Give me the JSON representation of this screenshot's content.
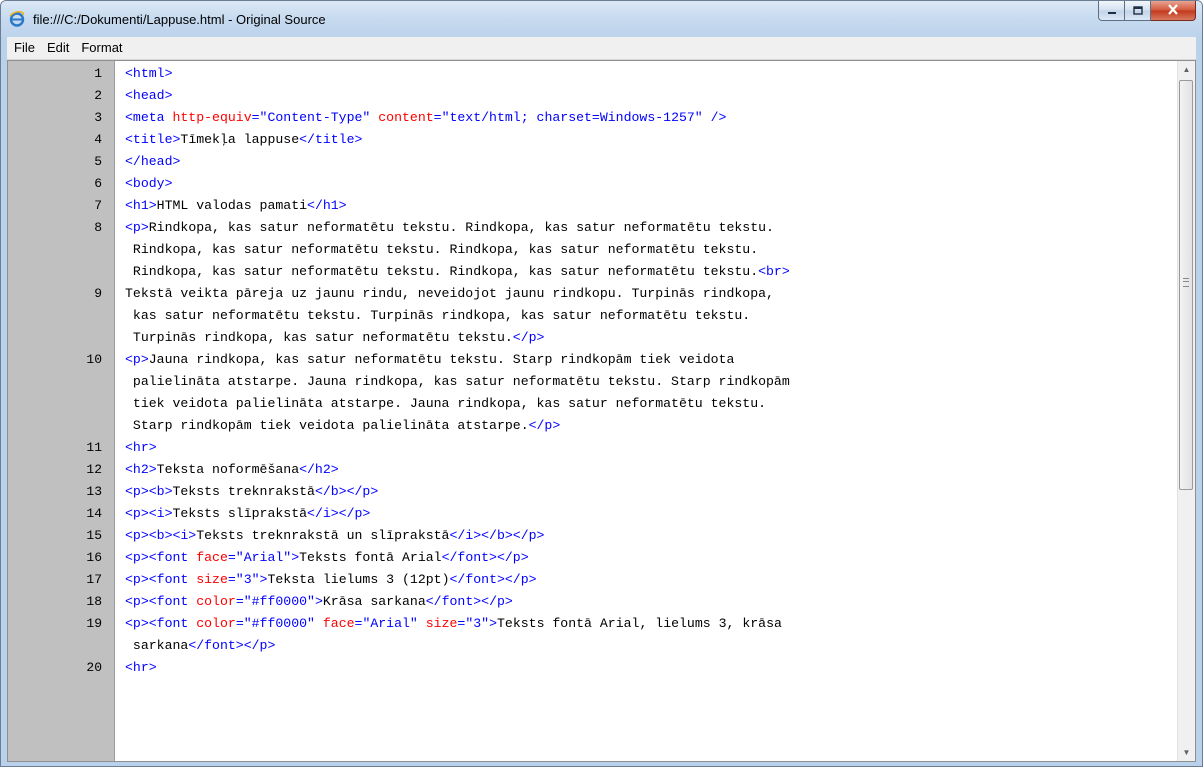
{
  "window": {
    "title": "file:///C:/Dokumenti/Lappuse.html - Original Source",
    "app_icon": "internet-explorer-icon",
    "buttons": {
      "minimize": "minimize-icon",
      "maximize": "maximize-icon",
      "close": "close-icon"
    }
  },
  "menu": {
    "items": [
      "File",
      "Edit",
      "Format"
    ]
  },
  "colors": {
    "tag": "#0000ff",
    "attribute": "#ff0000",
    "attribute_value": "#0000ff",
    "text": "#000000",
    "gutter": "#c0c0c0"
  },
  "source": {
    "lines": [
      {
        "num": "1",
        "rows": [
          [
            [
              "tag",
              "<html>"
            ]
          ]
        ]
      },
      {
        "num": "2",
        "rows": [
          [
            [
              "tag",
              "<head>"
            ]
          ]
        ]
      },
      {
        "num": "3",
        "rows": [
          [
            [
              "tag",
              "<meta "
            ],
            [
              "attr",
              "http-equiv"
            ],
            [
              "tag",
              "=\"Content-Type\" "
            ],
            [
              "attr",
              "content"
            ],
            [
              "tag",
              "=\"text/html; charset=Windows-1257\" />"
            ]
          ]
        ]
      },
      {
        "num": "4",
        "rows": [
          [
            [
              "tag",
              "<title>"
            ],
            [
              "text",
              "Tīmekļa lappuse"
            ],
            [
              "tag",
              "</title>"
            ]
          ]
        ]
      },
      {
        "num": "5",
        "rows": [
          [
            [
              "tag",
              "</head>"
            ]
          ]
        ]
      },
      {
        "num": "6",
        "rows": [
          [
            [
              "tag",
              "<body>"
            ]
          ]
        ]
      },
      {
        "num": "7",
        "rows": [
          [
            [
              "tag",
              "<h1>"
            ],
            [
              "text",
              "HTML valodas pamati"
            ],
            [
              "tag",
              "</h1>"
            ]
          ]
        ]
      },
      {
        "num": "8",
        "rows": [
          [
            [
              "tag",
              "<p>"
            ],
            [
              "text",
              "Rindkopa, kas satur neformatētu tekstu. Rindkopa, kas satur neformatētu tekstu."
            ]
          ],
          [
            [
              "text",
              " Rindkopa, kas satur neformatētu tekstu. Rindkopa, kas satur neformatētu tekstu."
            ]
          ],
          [
            [
              "text",
              " Rindkopa, kas satur neformatētu tekstu. Rindkopa, kas satur neformatētu tekstu."
            ],
            [
              "tag",
              "<br>"
            ]
          ]
        ]
      },
      {
        "num": "9",
        "rows": [
          [
            [
              "text",
              "Tekstā veikta pāreja uz jaunu rindu, neveidojot jaunu rindkopu. Turpinās rindkopa,"
            ]
          ],
          [
            [
              "text",
              " kas satur neformatētu tekstu. Turpinās rindkopa, kas satur neformatētu tekstu."
            ]
          ],
          [
            [
              "text",
              " Turpinās rindkopa, kas satur neformatētu tekstu."
            ],
            [
              "tag",
              "</p>"
            ]
          ]
        ]
      },
      {
        "num": "10",
        "rows": [
          [
            [
              "tag",
              "<p>"
            ],
            [
              "text",
              "Jauna rindkopa, kas satur neformatētu tekstu. Starp rindkopām tiek veidota"
            ]
          ],
          [
            [
              "text",
              " palielināta atstarpe. Jauna rindkopa, kas satur neformatētu tekstu. Starp rindkopām"
            ]
          ],
          [
            [
              "text",
              " tiek veidota palielināta atstarpe. Jauna rindkopa, kas satur neformatētu tekstu."
            ]
          ],
          [
            [
              "text",
              " Starp rindkopām tiek veidota palielināta atstarpe."
            ],
            [
              "tag",
              "</p>"
            ]
          ]
        ]
      },
      {
        "num": "11",
        "rows": [
          [
            [
              "tag",
              "<hr>"
            ]
          ]
        ]
      },
      {
        "num": "12",
        "rows": [
          [
            [
              "tag",
              "<h2>"
            ],
            [
              "text",
              "Teksta noformēšana"
            ],
            [
              "tag",
              "</h2>"
            ]
          ]
        ]
      },
      {
        "num": "13",
        "rows": [
          [
            [
              "tag",
              "<p><b>"
            ],
            [
              "text",
              "Teksts treknrakstā"
            ],
            [
              "tag",
              "</b></p>"
            ]
          ]
        ]
      },
      {
        "num": "14",
        "rows": [
          [
            [
              "tag",
              "<p><i>"
            ],
            [
              "text",
              "Teksts slīprakstā"
            ],
            [
              "tag",
              "</i></p>"
            ]
          ]
        ]
      },
      {
        "num": "15",
        "rows": [
          [
            [
              "tag",
              "<p><b><i>"
            ],
            [
              "text",
              "Teksts treknrakstā un slīprakstā"
            ],
            [
              "tag",
              "</i></b></p>"
            ]
          ]
        ]
      },
      {
        "num": "16",
        "rows": [
          [
            [
              "tag",
              "<p><font "
            ],
            [
              "attr",
              "face"
            ],
            [
              "tag",
              "=\"Arial\">"
            ],
            [
              "text",
              "Teksts fontā Arial"
            ],
            [
              "tag",
              "</font></p>"
            ]
          ]
        ]
      },
      {
        "num": "17",
        "rows": [
          [
            [
              "tag",
              "<p><font "
            ],
            [
              "attr",
              "size"
            ],
            [
              "tag",
              "=\"3\">"
            ],
            [
              "text",
              "Teksta lielums 3 (12pt)"
            ],
            [
              "tag",
              "</font></p>"
            ]
          ]
        ]
      },
      {
        "num": "18",
        "rows": [
          [
            [
              "tag",
              "<p><font "
            ],
            [
              "attr",
              "color"
            ],
            [
              "tag",
              "=\"#ff0000\">"
            ],
            [
              "text",
              "Krāsa sarkana"
            ],
            [
              "tag",
              "</font></p>"
            ]
          ]
        ]
      },
      {
        "num": "19",
        "rows": [
          [
            [
              "tag",
              "<p><font "
            ],
            [
              "attr",
              "color"
            ],
            [
              "tag",
              "=\"#ff0000\" "
            ],
            [
              "attr",
              "face"
            ],
            [
              "tag",
              "=\"Arial\" "
            ],
            [
              "attr",
              "size"
            ],
            [
              "tag",
              "=\"3\">"
            ],
            [
              "text",
              "Teksts fontā Arial, lielums 3, krāsa"
            ]
          ],
          [
            [
              "text",
              " sarkana"
            ],
            [
              "tag",
              "</font></p>"
            ]
          ]
        ]
      },
      {
        "num": "20",
        "rows": [
          [
            [
              "tag",
              "<hr>"
            ]
          ]
        ]
      }
    ]
  }
}
